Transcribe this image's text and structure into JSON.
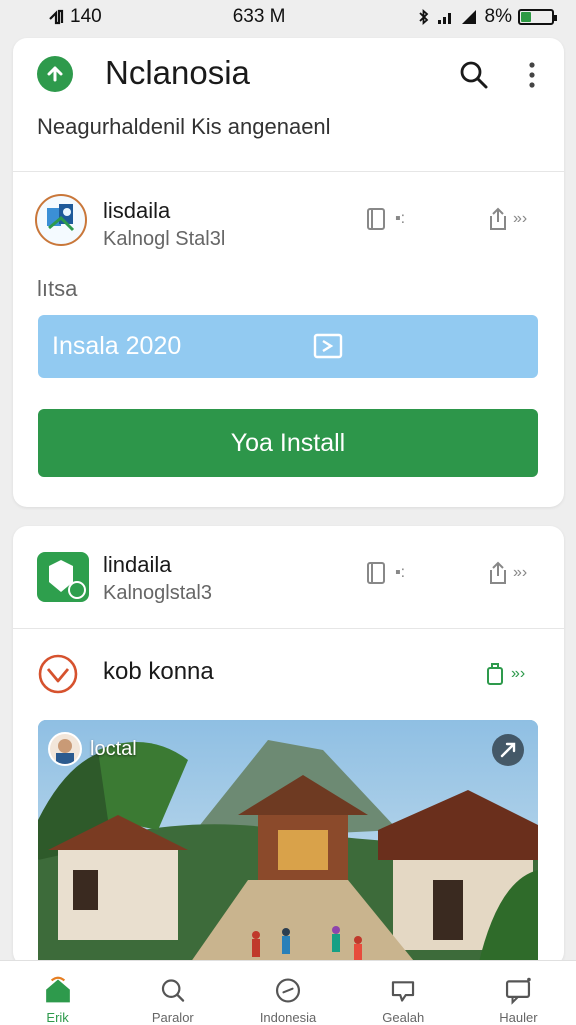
{
  "status_bar": {
    "left_text": "140",
    "time": "633 M",
    "battery_text": "8%",
    "battery_level_percent": 8
  },
  "header": {
    "title": "Nclanosia",
    "subtitle": "Neagurhaldenil Kis angenaenl",
    "icons": {
      "back": "up-arrow-icon",
      "search": "search-icon",
      "more": "more-vertical-icon"
    }
  },
  "app_1": {
    "name": "lisdaila",
    "sub": "Kalnogl Stal3l",
    "ctl_1_label": "▪:",
    "ctl_2_label": "»›"
  },
  "section": {
    "label": "lıtsa"
  },
  "field": {
    "value": "Insala 2020",
    "icon": "edit-icon"
  },
  "install_button": {
    "label": "Yoa Install"
  },
  "app_2": {
    "name": "lindaila",
    "sub": "Kalnoglstal3",
    "ctl_1_label": "▪:",
    "ctl_2_label": "»›"
  },
  "post": {
    "title": "kob konna",
    "ctl_label": "»›",
    "photo_label": "loctal"
  },
  "colors": {
    "accent_green": "#2d964a",
    "field_blue": "#92caf1",
    "icon_orange": "#c9773a"
  },
  "nav": {
    "items": [
      {
        "label": "Erik",
        "icon": "home-icon",
        "active": true
      },
      {
        "label": "Paralor",
        "icon": "search-icon",
        "active": false
      },
      {
        "label": "Indonesia",
        "icon": "compass-icon",
        "active": false
      },
      {
        "label": "Gealah",
        "icon": "chat-icon",
        "active": false
      },
      {
        "label": "Hauler",
        "icon": "message-icon",
        "active": false
      }
    ]
  }
}
